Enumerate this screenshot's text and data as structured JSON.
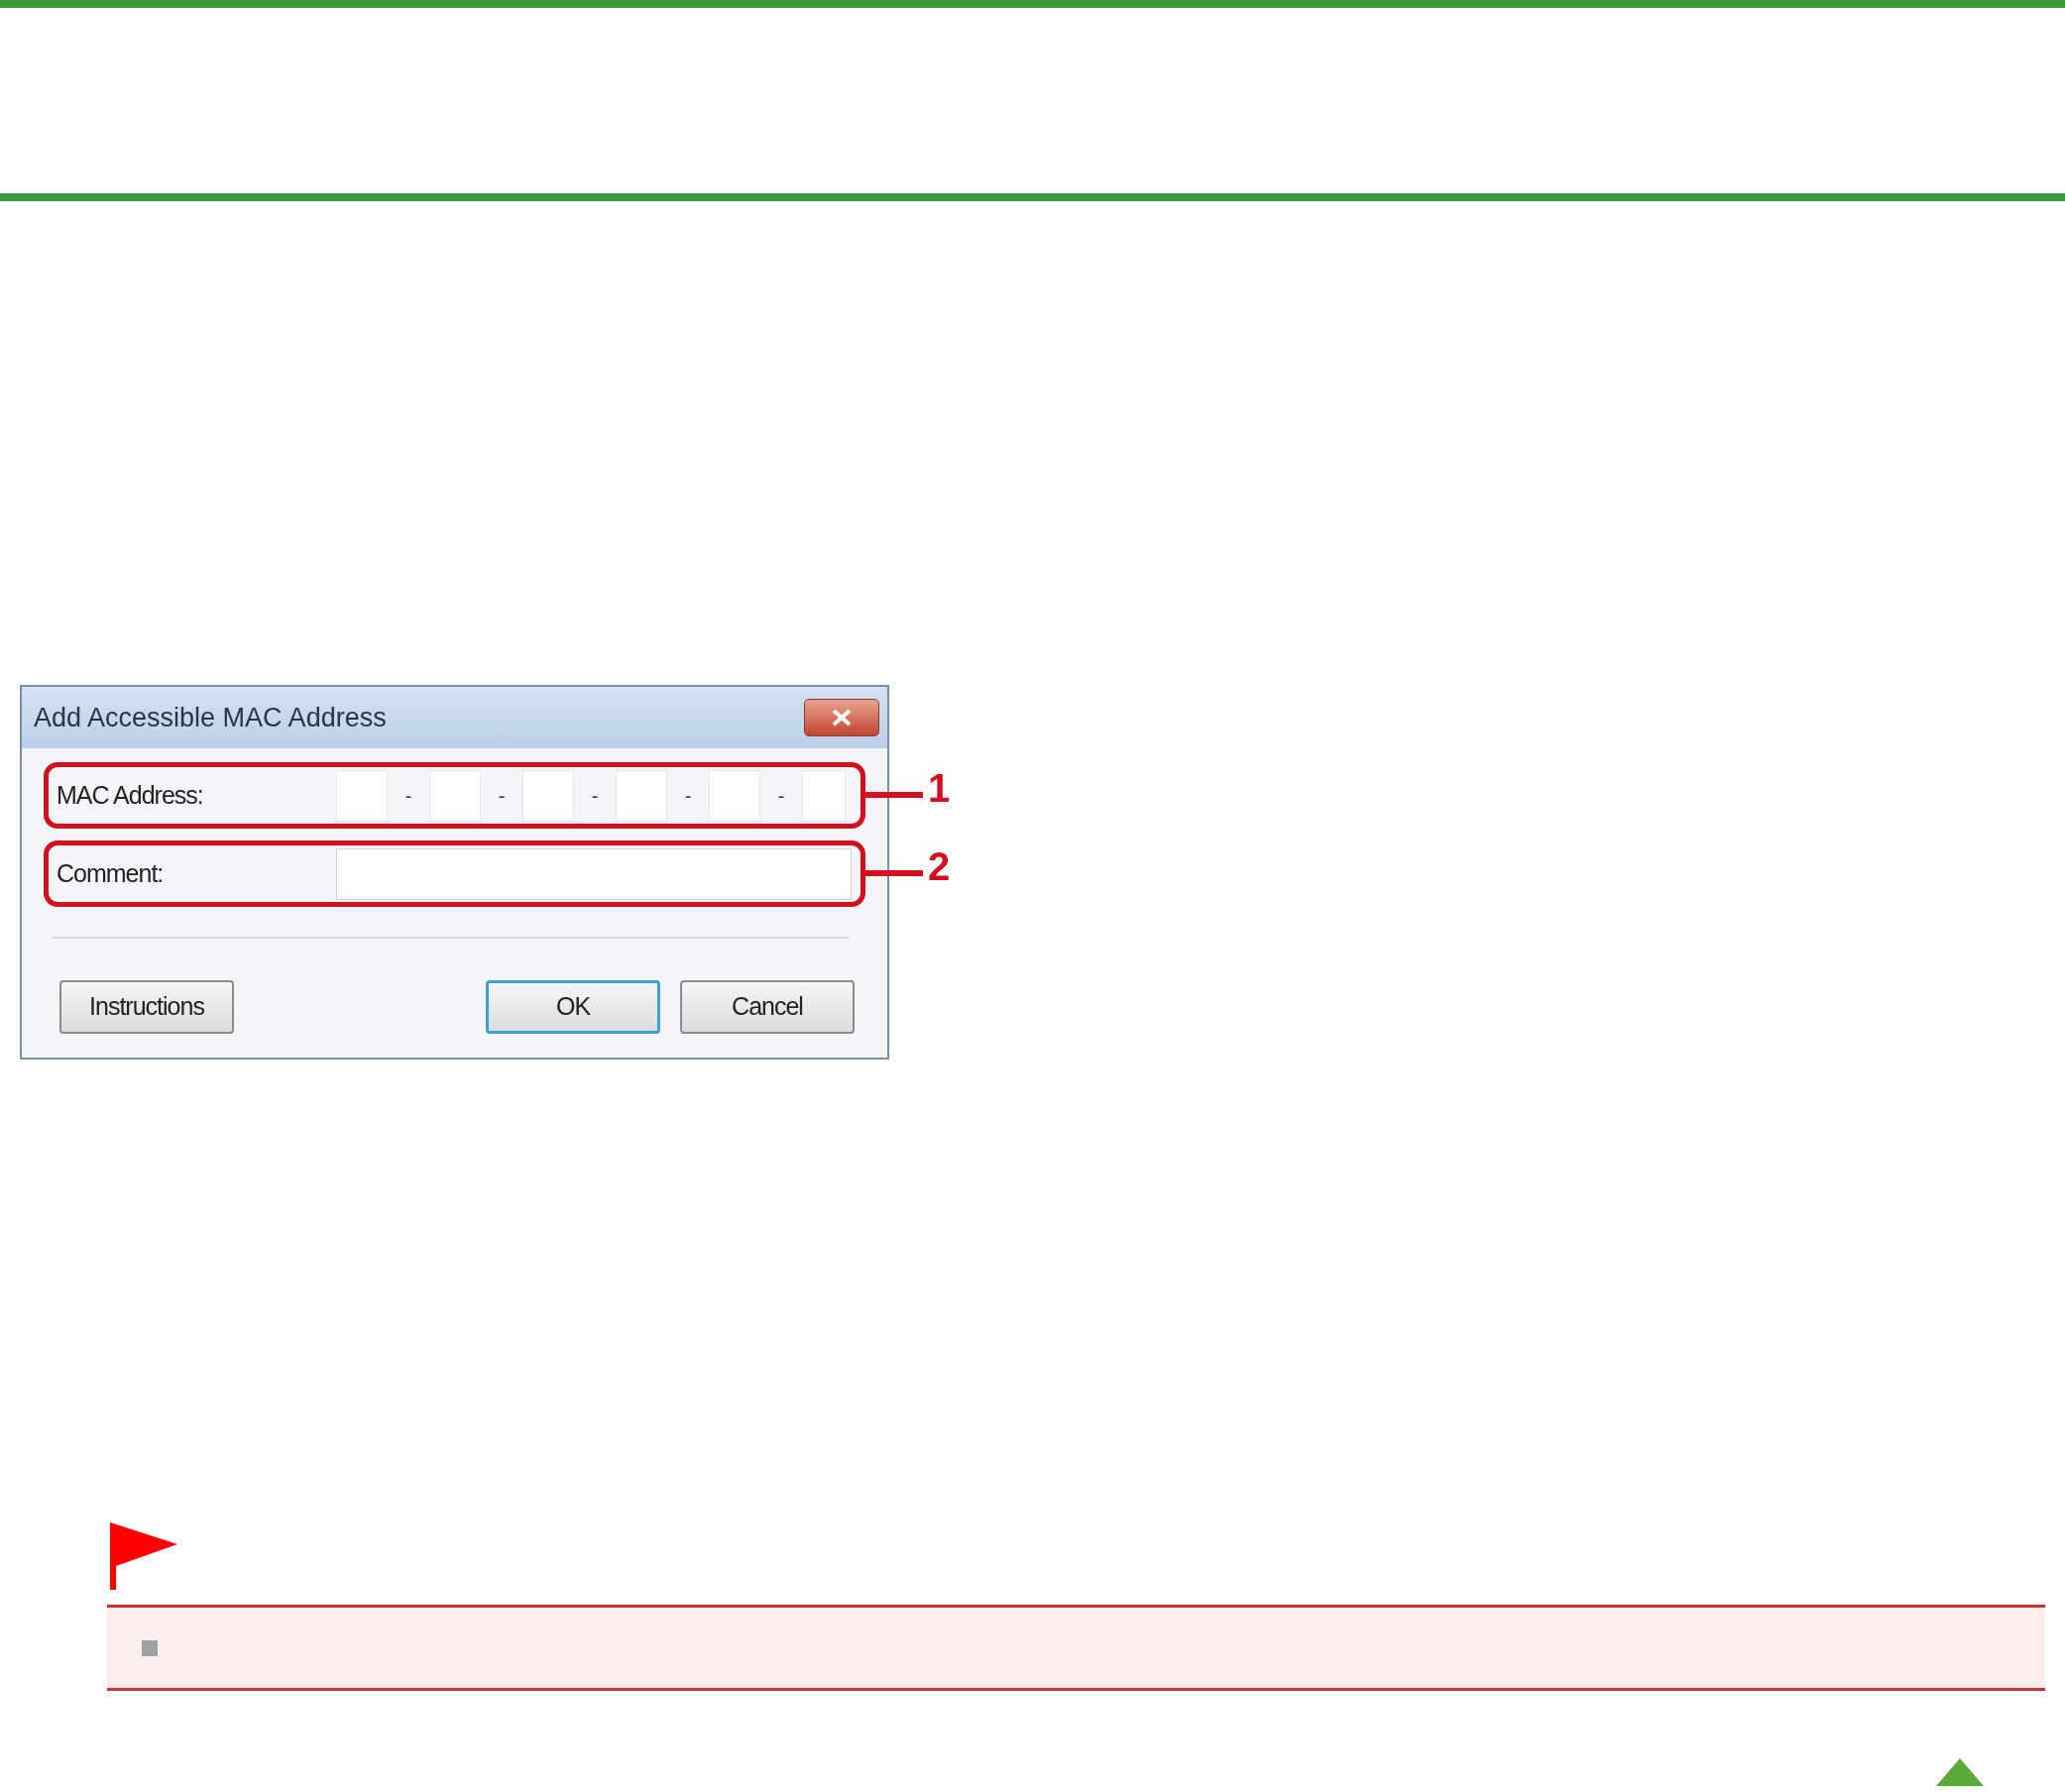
{
  "dialog": {
    "title": "Add Accessible MAC Address",
    "fields": [
      {
        "kind": "mac",
        "label": "MAC Address:",
        "separators": [
          "-",
          "-",
          "-",
          "-",
          "-"
        ],
        "callout": "1"
      },
      {
        "kind": "text",
        "label": "Comment:",
        "callout": "2"
      }
    ],
    "buttons": [
      {
        "label": "Instructions",
        "default": false
      },
      {
        "label": "OK",
        "default": true
      },
      {
        "label": "Cancel",
        "default": false
      }
    ]
  }
}
